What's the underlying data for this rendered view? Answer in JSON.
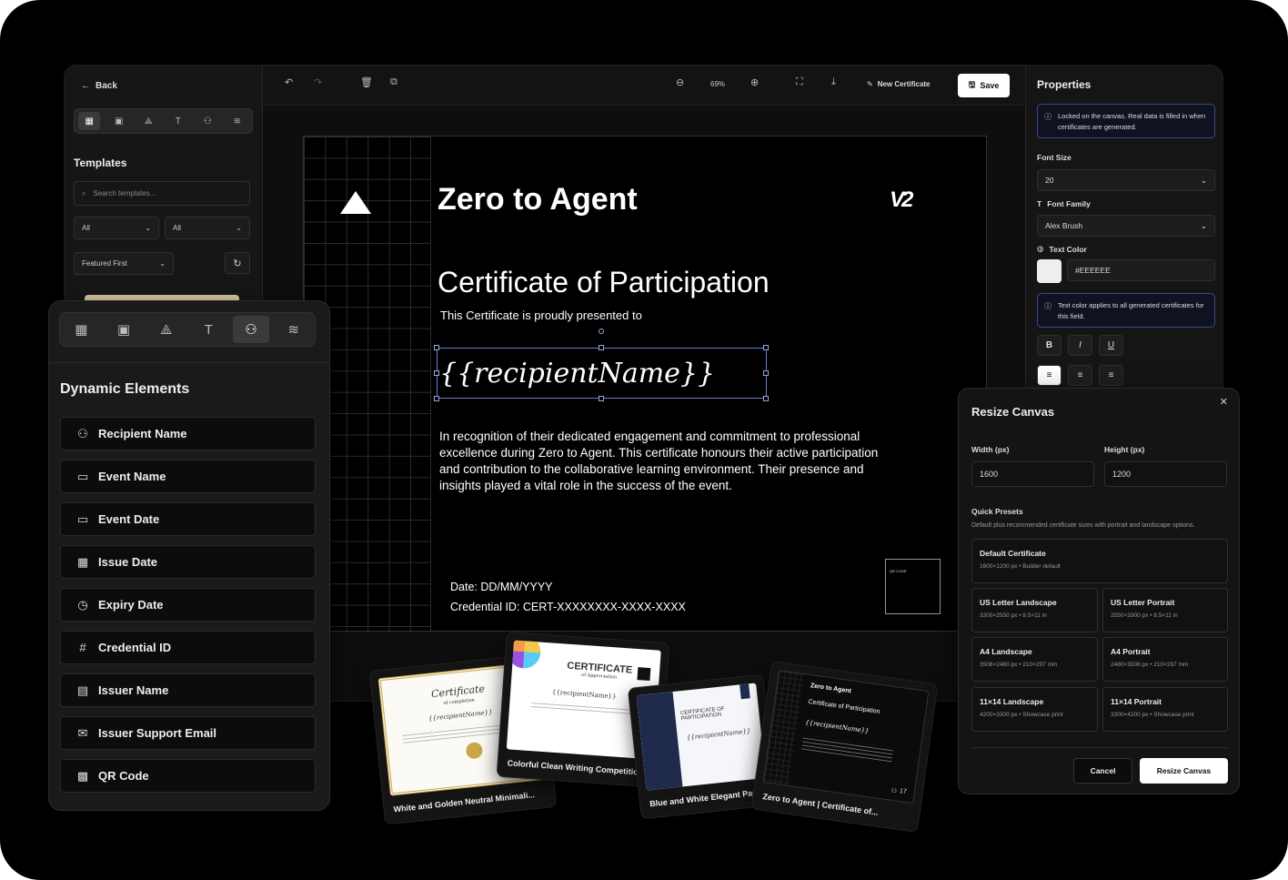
{
  "left_panel": {
    "back": "Back",
    "templates_heading": "Templates",
    "search_placeholder": "Search templates...",
    "filter_1": "All",
    "filter_2": "All",
    "sort": "Featured First"
  },
  "toolbar": {
    "zoom": "69%",
    "new_certificate": "New Certificate",
    "save": "Save"
  },
  "certificate": {
    "title": "Zero to Agent",
    "subtitle": "Certificate of Participation",
    "presented": "This Certificate is proudly presented to",
    "recipient": "{{recipientName}}",
    "body": "In recognition of their dedicated engagement and commitment to professional excellence during Zero to Agent. This certificate honours their active participation and contribution to the collaborative learning environment. Their presence and insights played a vital role in the success of the event.",
    "date": "Date: DD/MM/YYYY",
    "credential": "Credential ID: CERT-XXXXXXXX-XXXX-XXXX",
    "qr_label": "QR CODE",
    "logo": "V2"
  },
  "properties": {
    "heading": "Properties",
    "locked_note": "Locked on the canvas. Real data is filled in when certificates are generated.",
    "font_size_label": "Font Size",
    "font_size": "20",
    "font_family_label": "Font Family",
    "font_family": "Alex Brush",
    "text_color_label": "Text Color",
    "text_color": "#EEEEEE",
    "color_note": "Text color applies to all generated certificates for this field.",
    "bold": "B",
    "italic": "I",
    "underline": "U"
  },
  "dynamic_elements": {
    "heading": "Dynamic Elements",
    "items": [
      {
        "label": "Recipient Name",
        "icon": "user-icon"
      },
      {
        "label": "Event Name",
        "icon": "calendar-icon"
      },
      {
        "label": "Event Date",
        "icon": "calendar-icon"
      },
      {
        "label": "Issue Date",
        "icon": "calendar-grid-icon"
      },
      {
        "label": "Expiry Date",
        "icon": "clock-icon"
      },
      {
        "label": "Credential ID",
        "icon": "hash-icon"
      },
      {
        "label": "Issuer Name",
        "icon": "building-icon"
      },
      {
        "label": "Issuer Support Email",
        "icon": "mail-icon"
      },
      {
        "label": "QR Code",
        "icon": "qr-icon"
      }
    ]
  },
  "resize": {
    "heading": "Resize Canvas",
    "width_label": "Width (px)",
    "width": "1600",
    "height_label": "Height (px)",
    "height": "1200",
    "presets_heading": "Quick Presets",
    "presets_desc": "Default plus recommended certificate sizes with portrait and landscape options.",
    "presets": [
      {
        "name": "Default Certificate",
        "desc": "1600×1200 px • Builder default"
      },
      {
        "name": "US Letter Landscape",
        "desc": "3300×2550 px • 8.5×11 in"
      },
      {
        "name": "US Letter Portrait",
        "desc": "2550×3300 px • 8.5×11 in"
      },
      {
        "name": "A4 Landscape",
        "desc": "3508×2480 px • 210×297 mm"
      },
      {
        "name": "A4 Portrait",
        "desc": "2480×3508 px • 210×297 mm"
      },
      {
        "name": "11×14 Landscape",
        "desc": "4200×3300 px • Showcase print"
      },
      {
        "name": "11×14 Portrait",
        "desc": "3300×4200 px • Showcase print"
      }
    ],
    "cancel": "Cancel",
    "submit": "Resize Canvas"
  },
  "template_cards": [
    {
      "name": "White and Golden Neutral Minimali..."
    },
    {
      "name": "Colorful Clean Writing Competition..."
    },
    {
      "name": "Blue and White Elegant Partic"
    },
    {
      "name": "Zero to Agent | Certificate of..."
    }
  ],
  "mini": {
    "cert1_title": "Certificate",
    "cert1_sub": "of completion",
    "cert1_name": "{{recipientName}}",
    "cert2_title": "CERTIFICATE",
    "cert2_sub": "of Appreciation",
    "cert2_name": "{{recipientName}}",
    "cert3_title": "CERTIFICATE OF PARTICIPATION",
    "cert3_name": "{{recipientName}}",
    "cert4_title": "Zero to Agent",
    "cert4_sub": "Certificate of Participation",
    "cert4_name": "{{recipientName}}",
    "cert4_count": "17"
  }
}
